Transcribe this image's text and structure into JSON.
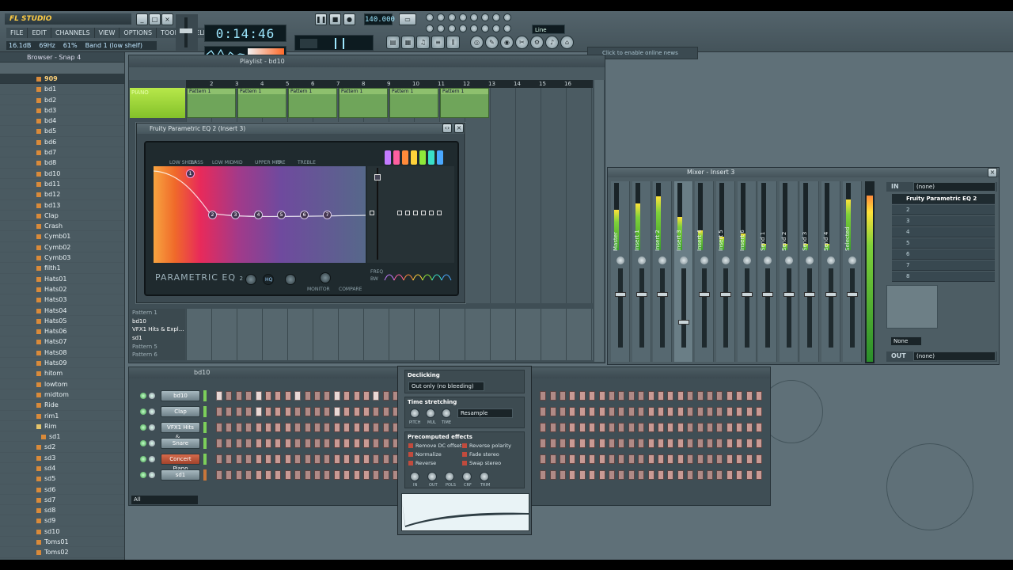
{
  "app": {
    "logo": "FL STUDIO",
    "menu": [
      "FILE",
      "EDIT",
      "CHANNELS",
      "VIEW",
      "OPTIONS",
      "TOOLS",
      "HELP"
    ]
  },
  "hint": {
    "level": "16.1dB",
    "freq": "69Hz",
    "pct": "61%",
    "band": "Band 1 (low shelf)"
  },
  "transport": {
    "time": "0:14:46",
    "tempo": "140.000",
    "output": "Line",
    "online": "Click to enable online news"
  },
  "browser": {
    "title": "Browser - Snap 4",
    "items": [
      "909",
      "bd1",
      "bd2",
      "bd3",
      "bd4",
      "bd5",
      "bd6",
      "bd7",
      "bd8",
      "bd10",
      "bd11",
      "bd12",
      "bd13",
      "Clap",
      "Crash",
      "Cymb01",
      "Cymb02",
      "Cymb03",
      "filth1",
      "Hats01",
      "Hats02",
      "Hats03",
      "Hats04",
      "Hats05",
      "Hats06",
      "Hats07",
      "Hats08",
      "Hats09",
      "hitom",
      "lowtom",
      "midtom",
      "Ride",
      "rim1",
      "Rim",
      "sd1",
      "sd2",
      "sd3",
      "sd4",
      "sd5",
      "sd6",
      "sd7",
      "sd8",
      "sd9",
      "sd10",
      "Toms01",
      "Toms02"
    ]
  },
  "playlist": {
    "title": "Playlist - bd10",
    "ruler": [
      "2",
      "3",
      "4",
      "5",
      "6",
      "7",
      "8",
      "9",
      "10",
      "11",
      "12",
      "13",
      "14",
      "15",
      "16"
    ],
    "track1": "PIANO",
    "pattern_label": "Pattern 1",
    "patterns": [
      "Pattern 1",
      "bd10",
      "VFX1 Hits & Expl...",
      "sd1",
      "Pattern 5",
      "Pattern 6"
    ]
  },
  "eq": {
    "title": "Fruity Parametric EQ 2 (Insert 3)",
    "brand": "PARAMETRIC EQ",
    "brand_sub": "2",
    "labels": {
      "hq": "HQ",
      "monitor": "MONITOR",
      "compare": "COMPARE",
      "freq": "FREQ",
      "bw": "BW"
    },
    "nodes": [
      "1",
      "2",
      "3",
      "4",
      "5",
      "6",
      "7"
    ],
    "band_types": [
      "LOW SHELF",
      "BASS",
      "LOW MID",
      "MID",
      "UPPER MID",
      "PRE",
      "TREBLE"
    ]
  },
  "mixer": {
    "title": "Mixer - Insert 3",
    "in_label": "IN",
    "in_value": "(none)",
    "out_label": "OUT",
    "out_value": "(none)",
    "strips": [
      "Master",
      "Insert 1",
      "Insert 2",
      "Insert 3",
      "Insert 4",
      "Insert 5",
      "Insert 6",
      "Send 1",
      "Send 2",
      "Send 3",
      "Send 4",
      "Selected"
    ],
    "fx": [
      "Fruity Parametric EQ 2",
      "2",
      "3",
      "4",
      "5",
      "6",
      "7",
      "8"
    ],
    "preset": "None"
  },
  "stepseq": {
    "title": "bd10",
    "filter": "All",
    "channels": [
      "bd10",
      "Clap",
      "VFX1 Hits &...",
      "Snare",
      "Concert Piano",
      "sd1"
    ]
  },
  "sample": {
    "declicking_title": "Declicking",
    "declicking_value": "Out only (no bleeding)",
    "stretch_title": "Time stretching",
    "stretch_mode": "Resample",
    "stretch_knobs": [
      "PITCH",
      "MUL",
      "TIME"
    ],
    "precomp_title": "Precomputed effects",
    "effects_left": [
      "Remove DC offset",
      "Normalize",
      "Reverse"
    ],
    "effects_right": [
      "Reverse polarity",
      "Fade stereo",
      "Swap stereo"
    ],
    "env_knobs": [
      "IN",
      "OUT",
      "POLS",
      "CRF",
      "TRIM"
    ]
  }
}
